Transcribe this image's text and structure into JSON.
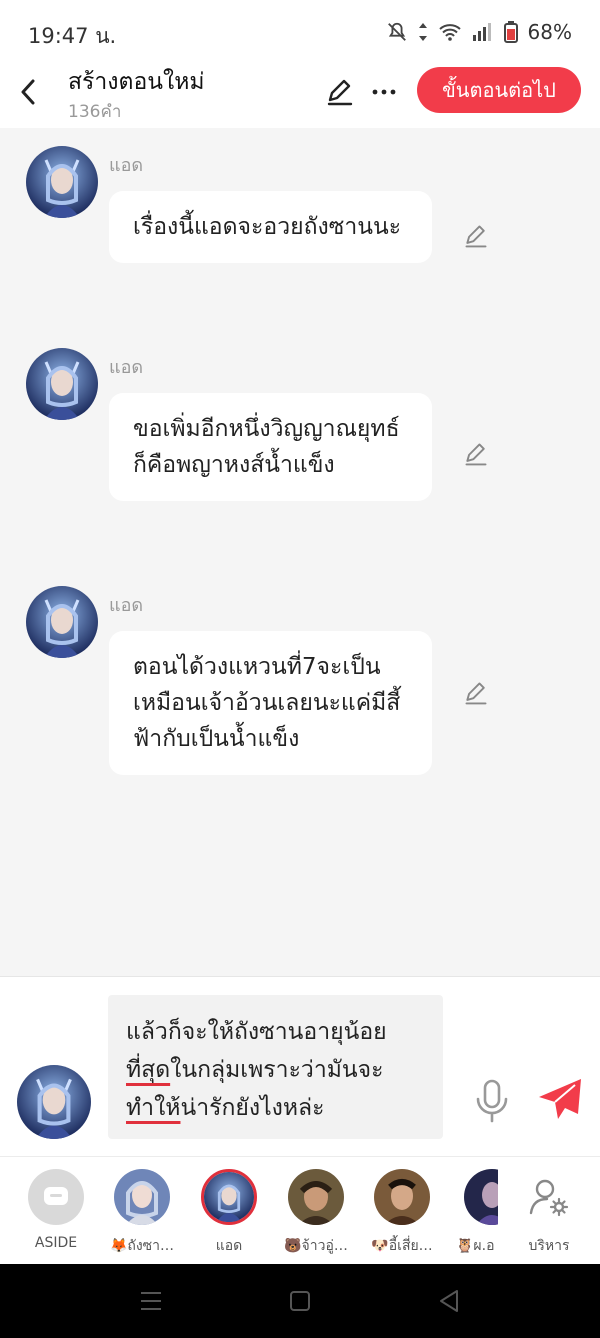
{
  "status_bar": {
    "time": "19:47 น.",
    "battery": "68%"
  },
  "header": {
    "title": "สร้างตอนใหม่",
    "word_count": "136คำ",
    "next_label": "ขั้นตอนต่อไป",
    "accent_color": "#f23c4a"
  },
  "messages": [
    {
      "sender": "แอด",
      "text": "เรื่องนี้แอดจะอวยถังซานนะ"
    },
    {
      "sender": "แอด",
      "text": "ขอเพิ่มอีกหนึ่งวิญญาณยุทธ์ก็คือพญาหงส์น้ำแข็ง"
    },
    {
      "sender": "แอด",
      "text": "ตอนได้วงแหวนที่7จะเป็นเหมือนเจ้าอ้วนเลยนะแค่มีสี้ฟ้ากับเป็นน้ำแข็ง"
    }
  ],
  "composer": {
    "text_a": "แล้วก็จะให้ถังซานอายุน้อย",
    "text_u1": "ที่สุด",
    "text_b": "ในกลุ่มเพราะว่ามันจะ",
    "text_u2": "ทำให้",
    "text_c": "น่ารักยังไงหล่ะ"
  },
  "characters": [
    {
      "label": "ASIDE",
      "icon": "chat-bubble-icon"
    },
    {
      "label": "🦊ถังซา…"
    },
    {
      "label": "แอด",
      "selected": true
    },
    {
      "label": "🐻จ้าวอู่…"
    },
    {
      "label": "🐶อี้เสี่ย…"
    },
    {
      "label": "🦉ผ.อ"
    },
    {
      "label": "บริหาร",
      "icon": "user-settings-icon"
    }
  ]
}
